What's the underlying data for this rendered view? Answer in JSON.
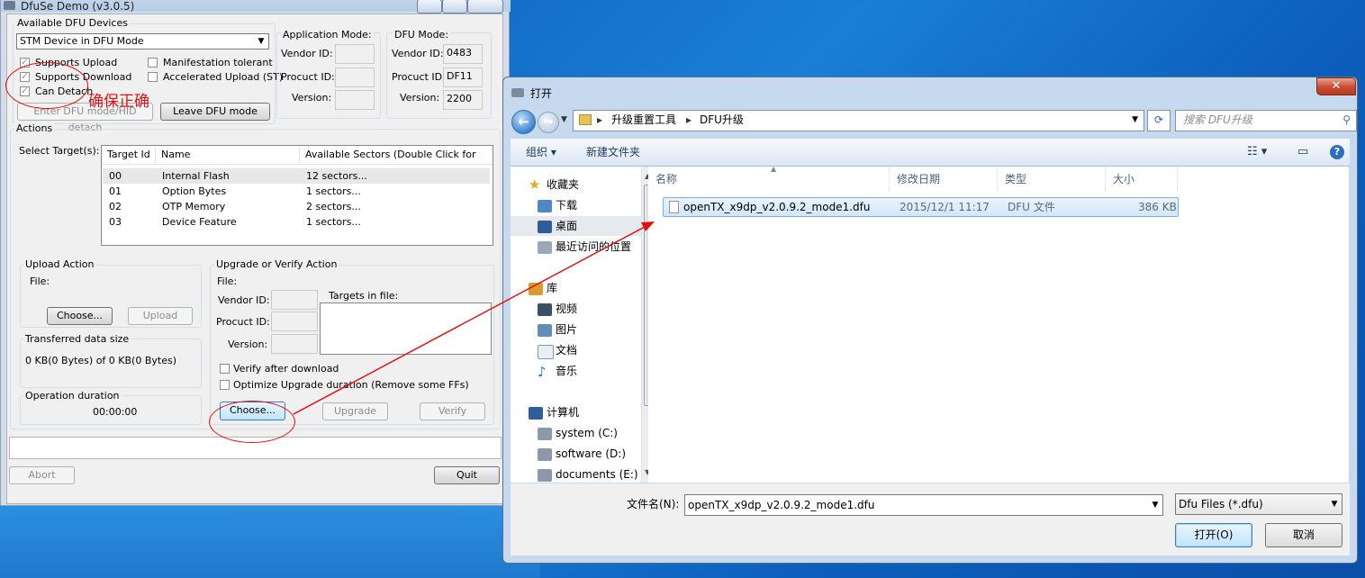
{
  "dfuse": {
    "title": "DfuSe Demo (v3.0.5)",
    "devices_group": "Available DFU Devices",
    "device_selected": "STM Device in DFU Mode",
    "cb_supports_upload": "Supports Upload",
    "cb_supports_download": "Supports Download",
    "cb_can_detach": "Can Detach",
    "cb_manifestation": "Manifestation tolerant",
    "cb_accelerated": "Accelerated Upload (ST)",
    "btn_enter_dfu": "Enter DFU mode/HID detach",
    "btn_leave_dfu": "Leave DFU mode",
    "app_mode": {
      "title": "Application Mode:",
      "vendor": "Vendor ID:",
      "product": "Procuct ID:",
      "version": "Version:"
    },
    "dfu_mode": {
      "title": "DFU Mode:",
      "vendor": "Vendor ID:",
      "vendor_val": "0483",
      "product": "Procuct ID:",
      "product_val": "DF11",
      "version": "Version:",
      "version_val": "2200"
    },
    "actions_title": "Actions",
    "select_targets": "Select Target(s):",
    "targets_headers": [
      "Target Id",
      "Name",
      "Available Sectors (Double Click for more)"
    ],
    "targets": [
      {
        "id": "00",
        "name": "Internal Flash",
        "sectors": "12 sectors..."
      },
      {
        "id": "01",
        "name": "Option Bytes",
        "sectors": "1 sectors..."
      },
      {
        "id": "02",
        "name": "OTP Memory",
        "sectors": "2 sectors..."
      },
      {
        "id": "03",
        "name": "Device Feature",
        "sectors": "1 sectors..."
      }
    ],
    "upload": {
      "title": "Upload Action",
      "file": "File:",
      "choose": "Choose...",
      "upload": "Upload"
    },
    "transferred": {
      "title": "Transferred data size",
      "value": "0 KB(0 Bytes) of 0 KB(0 Bytes)"
    },
    "duration": {
      "title": "Operation duration",
      "value": "00:00:00"
    },
    "upgrade": {
      "title": "Upgrade or Verify Action",
      "file": "File:",
      "vendor": "Vendor ID:",
      "product": "Procuct ID:",
      "version": "Version:",
      "targets_in_file": "Targets in file:",
      "verify_after": "Verify after download",
      "optimize": "Optimize Upgrade duration (Remove some FFs)",
      "choose": "Choose...",
      "upgrade": "Upgrade",
      "verify": "Verify"
    },
    "abort": "Abort",
    "quit": "Quit",
    "annotation": "确保正确"
  },
  "dialog": {
    "title": "打开",
    "close": "✕",
    "path": [
      "升级重置工具",
      "DFU升级"
    ],
    "search_placeholder": "搜索 DFU升级",
    "organize": "组织 ▾",
    "new_folder": "新建文件夹",
    "nav": {
      "favorites": "收藏夹",
      "downloads": "下载",
      "desktop": "桌面",
      "recent": "最近访问的位置",
      "libraries": "库",
      "videos": "视频",
      "pictures": "图片",
      "documents": "文档",
      "music": "音乐",
      "computer": "计算机",
      "drive_c": "system (C:)",
      "drive_d": "software (D:)",
      "drive_e": "documents (E:)"
    },
    "columns": [
      "名称",
      "修改日期",
      "类型",
      "大小"
    ],
    "files": [
      {
        "name": "openTX_x9dp_v2.0.9.2_mode1.dfu",
        "date": "2015/12/1 11:17",
        "type": "DFU 文件",
        "size": "386 KB"
      }
    ],
    "filename_label": "文件名(N):",
    "filename_value": "openTX_x9dp_v2.0.9.2_mode1.dfu",
    "filter": "Dfu Files (*.dfu)",
    "open": "打开(O)",
    "cancel": "取消"
  },
  "colors": {
    "annotation": "#e01010",
    "accent": "#3c7fb1"
  }
}
